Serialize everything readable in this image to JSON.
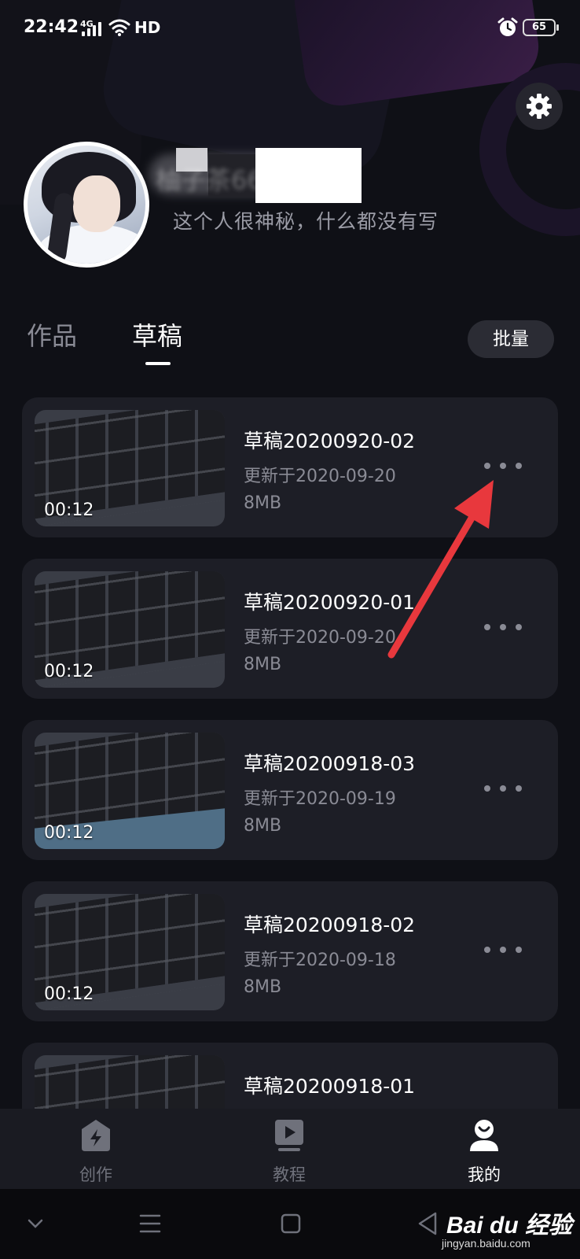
{
  "status_bar": {
    "time": "22:42",
    "network": "4G",
    "hd": "HD",
    "battery": "65"
  },
  "profile": {
    "nickname": "柚子茶666",
    "bio": "这个人很神秘，什么都没有写"
  },
  "tabs": [
    {
      "label": "作品",
      "active": false
    },
    {
      "label": "草稿",
      "active": true
    }
  ],
  "batch_button": "批量",
  "drafts": [
    {
      "title": "草稿20200920-02",
      "updated": "更新于2020-09-20",
      "size": "8MB",
      "duration": "00:12"
    },
    {
      "title": "草稿20200920-01",
      "updated": "更新于2020-09-20",
      "size": "8MB",
      "duration": "00:12"
    },
    {
      "title": "草稿20200918-03",
      "updated": "更新于2020-09-19",
      "size": "8MB",
      "duration": "00:12"
    },
    {
      "title": "草稿20200918-02",
      "updated": "更新于2020-09-18",
      "size": "8MB",
      "duration": "00:12"
    },
    {
      "title": "草稿20200918-01",
      "updated": "",
      "size": "",
      "duration": ""
    }
  ],
  "bottom_nav": [
    {
      "label": "创作",
      "icon": "lightning-icon",
      "active": false
    },
    {
      "label": "教程",
      "icon": "tutorial-icon",
      "active": false
    },
    {
      "label": "我的",
      "icon": "profile-icon",
      "active": true
    }
  ],
  "watermark": {
    "brand": "Bai du 经验",
    "site": "jingyan.baidu.com"
  },
  "colors": {
    "background": "#0f1016",
    "card": "#1d1e26",
    "secondary_text": "#8a8b95",
    "annotation_arrow": "#e8383d"
  }
}
